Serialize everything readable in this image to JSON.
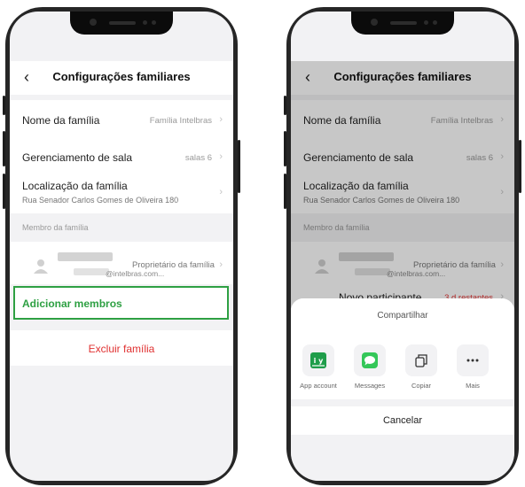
{
  "left_screen": {
    "title": "Configurações familiares",
    "rows": {
      "family_name": {
        "label": "Nome da família",
        "value": "Família Intelbras"
      },
      "room_mgmt": {
        "label": "Gerenciamento de sala",
        "value": "salas 6"
      },
      "location": {
        "label": "Localização da família",
        "address": "Rua Senador Carlos Gomes de Oliveira 180"
      }
    },
    "members_section": "Membro da família",
    "member": {
      "role": "Proprietário da família",
      "email": "@intelbras.com..."
    },
    "add_members": "Adicionar membros",
    "delete_family": "Excluir família"
  },
  "right_screen": {
    "title": "Configurações familiares",
    "rows": {
      "family_name": {
        "label": "Nome da família",
        "value": "Família Intelbras"
      },
      "room_mgmt": {
        "label": "Gerenciamento de sala",
        "value": "salas 6"
      },
      "location": {
        "label": "Localização da família",
        "address": "Rua Senador Carlos Gomes de Oliveira 180"
      }
    },
    "members_section": "Membro da família",
    "member": {
      "role": "Proprietário da família",
      "email": "@intelbras.com..."
    },
    "new_participant": {
      "label": "Novo participante",
      "status": "3 d restantes"
    },
    "share_sheet": {
      "title": "Compartilhar",
      "items": [
        {
          "label": "App account",
          "icon": "app-account-icon"
        },
        {
          "label": "Messages",
          "icon": "messages-icon"
        },
        {
          "label": "Copiar",
          "icon": "copy-icon"
        },
        {
          "label": "Mais",
          "icon": "more-icon"
        }
      ],
      "cancel": "Cancelar"
    }
  },
  "colors": {
    "accent_green": "#2ea043",
    "danger_red": "#e03131"
  }
}
